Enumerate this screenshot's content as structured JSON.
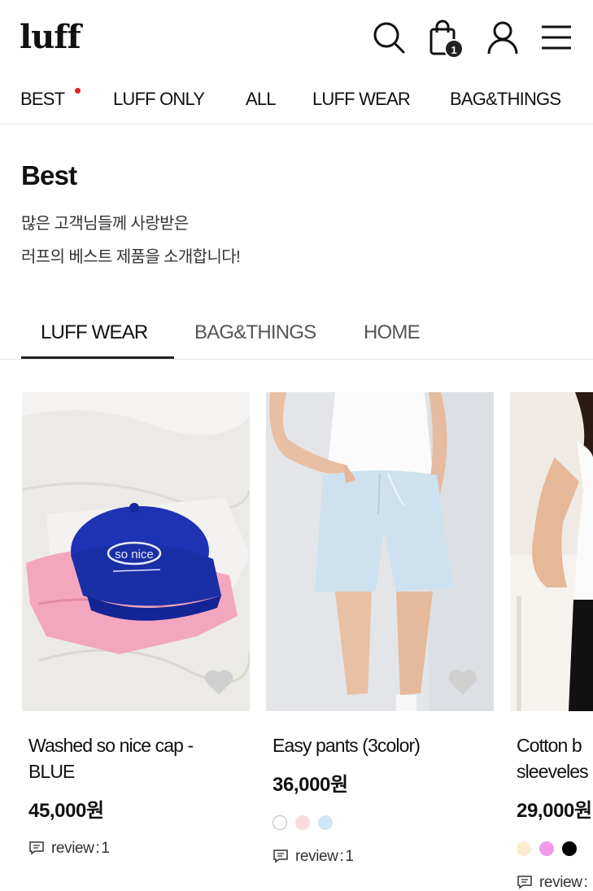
{
  "header": {
    "logo": "luff",
    "icons": [
      "search-icon",
      "shopping-bag-icon",
      "user-icon",
      "menu-icon"
    ],
    "cart_count": "1"
  },
  "nav": {
    "items": [
      {
        "label": "BEST",
        "has_dot": true
      },
      {
        "label": "LUFF ONLY"
      },
      {
        "label": "ALL"
      },
      {
        "label": "LUFF WEAR"
      },
      {
        "label": "BAG&THINGS"
      }
    ],
    "dot_color": "#e02020"
  },
  "section": {
    "title": "Best",
    "desc_line1": "많은 고객님들께 사랑받은",
    "desc_line2": "러프의 베스트 제품을 소개합니다!"
  },
  "tabs": [
    {
      "label": "LUFF WEAR",
      "active": true
    },
    {
      "label": "BAG&THINGS",
      "active": false
    },
    {
      "label": "HOME",
      "active": false
    }
  ],
  "products": [
    {
      "name_line1": "Washed so nice cap -",
      "name_line2": "BLUE",
      "price": "45,000원",
      "swatches": [],
      "review_label": "review",
      "review_sep": ":",
      "review_count": "1",
      "cap_text": "so nice"
    },
    {
      "name_line1": "Easy pants (3color)",
      "name_line2": "",
      "price": "36,000원",
      "swatches": [
        "#ffffff",
        "#fbd9dc",
        "#cfe6f6"
      ],
      "review_label": "review",
      "review_sep": ":",
      "review_count": "1"
    },
    {
      "name_line1": "Cotton b",
      "name_line2": "sleeveles",
      "price": "29,000원",
      "swatches": [
        "#f9ecd0",
        "#f09bea",
        "#000000"
      ],
      "review_label": "review",
      "review_sep": ":",
      "review_count": ""
    }
  ],
  "colors": {
    "text": "#111111",
    "border": "#e6e6e6",
    "heart": "#cfcfcf"
  }
}
